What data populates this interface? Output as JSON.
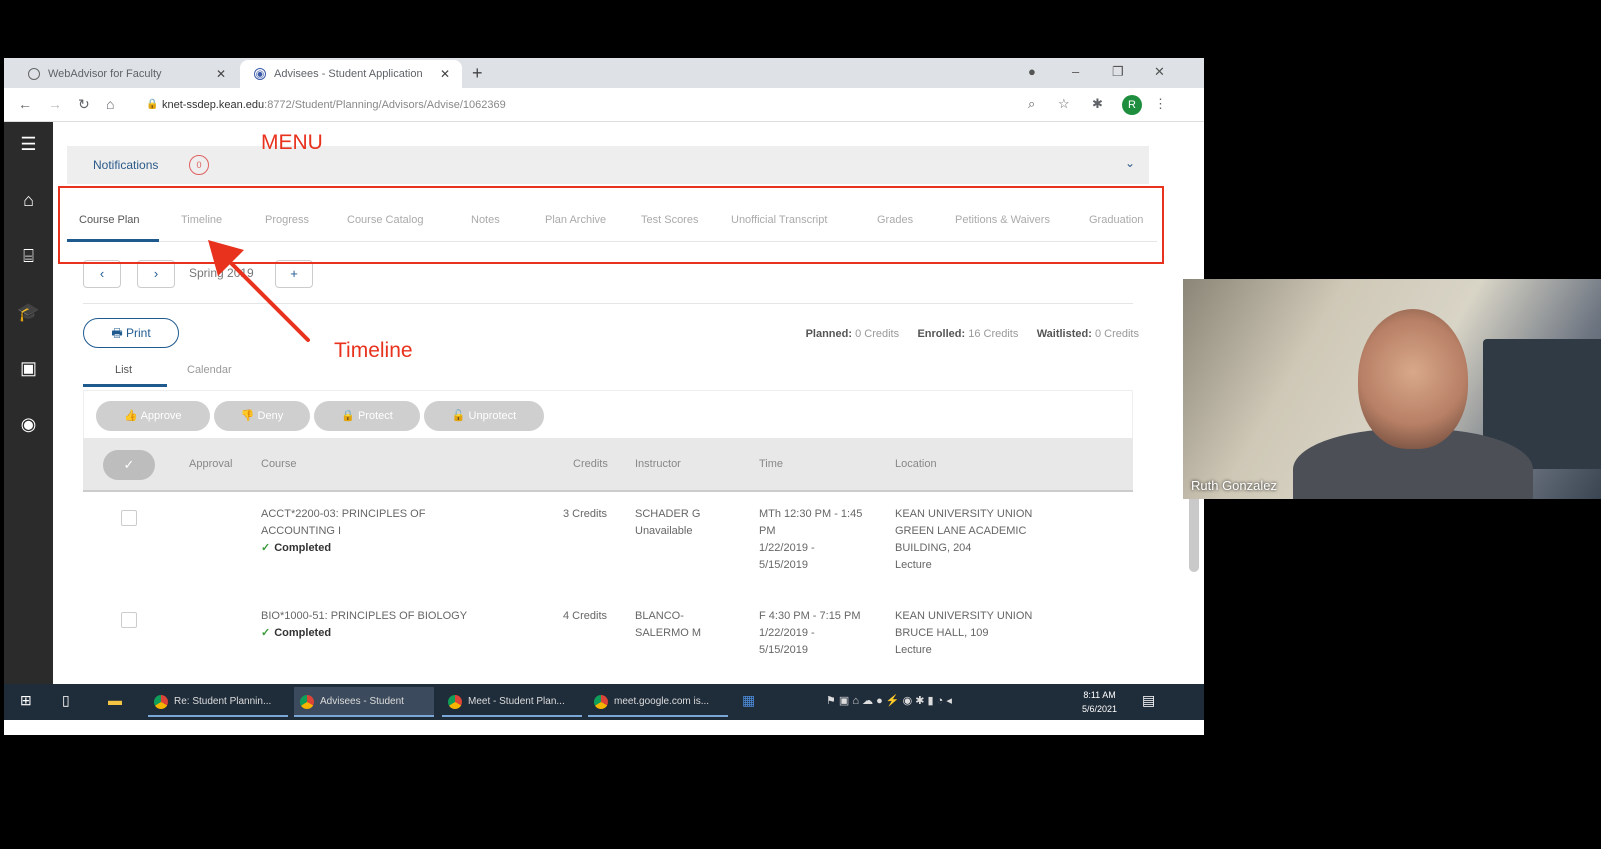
{
  "browser": {
    "tabs": [
      {
        "label": "WebAdvisor for Faculty"
      },
      {
        "label": "Advisees - Student Application"
      }
    ],
    "new_tab": "+",
    "url_host": "knet-ssdep.kean.edu",
    "url_path": ":8772/Student/Planning/Advisors/Advise/1062369",
    "profile_initial": "R"
  },
  "app": {
    "notifications_label": "Notifications",
    "notifications_count": "0",
    "nav_tabs": [
      "Course Plan",
      "Timeline",
      "Progress",
      "Course Catalog",
      "Notes",
      "Plan Archive",
      "Test Scores",
      "Unofficial Transcript",
      "Grades",
      "Petitions & Waivers",
      "Graduation"
    ],
    "active_tab": "Course Plan",
    "term_name": "Spring 2019",
    "print_label": "Print",
    "credits": {
      "planned_label": "Planned:",
      "planned_value": "0 Credits",
      "enrolled_label": "Enrolled:",
      "enrolled_value": "16 Credits",
      "waitlisted_label": "Waitlisted:",
      "waitlisted_value": "0 Credits"
    },
    "view_tabs": [
      "List",
      "Calendar"
    ],
    "actions": [
      "Approve",
      "Deny",
      "Protect",
      "Unprotect"
    ],
    "table_headers": [
      "Approval",
      "Course",
      "Credits",
      "Instructor",
      "Time",
      "Location"
    ],
    "rows": [
      {
        "course_line1": "ACCT*2200-03: PRINCIPLES OF",
        "course_line2": "ACCOUNTING I",
        "status": "Completed",
        "credits": "3 Credits",
        "instructor_line1": "SCHADER G",
        "instructor_line2": "Unavailable",
        "time_line1": "MTh 12:30 PM - 1:45",
        "time_line2": "PM",
        "time_line3": "1/22/2019 -",
        "time_line4": "5/15/2019",
        "location_line1": "KEAN UNIVERSITY UNION",
        "location_line2": "GREEN LANE ACADEMIC",
        "location_line3": "BUILDING, 204",
        "location_line4": "Lecture"
      },
      {
        "course_line1": "BIO*1000-51: PRINCIPLES OF BIOLOGY",
        "course_line2": "",
        "status": "Completed",
        "credits": "4 Credits",
        "instructor_line1": "BLANCO-",
        "instructor_line2": "SALERMO M",
        "time_line1": "F 4:30 PM - 7:15 PM",
        "time_line2": "1/22/2019 -",
        "time_line3": "5/15/2019",
        "time_line4": "",
        "location_line1": "KEAN UNIVERSITY UNION",
        "location_line2": "BRUCE HALL, 109",
        "location_line3": "Lecture",
        "location_line4": ""
      }
    ]
  },
  "taskbar": {
    "items": [
      "Re: Student Plannin...",
      "Advisees - Student",
      "Meet - Student Plan...",
      "meet.google.com is..."
    ],
    "clock_time": "8:11 AM",
    "clock_date": "5/6/2021"
  },
  "annotations": {
    "menu_label": "MENU",
    "timeline_label": "Timeline",
    "color": "#e8321d"
  },
  "video": {
    "participant_name": "Ruth Gonzalez"
  }
}
